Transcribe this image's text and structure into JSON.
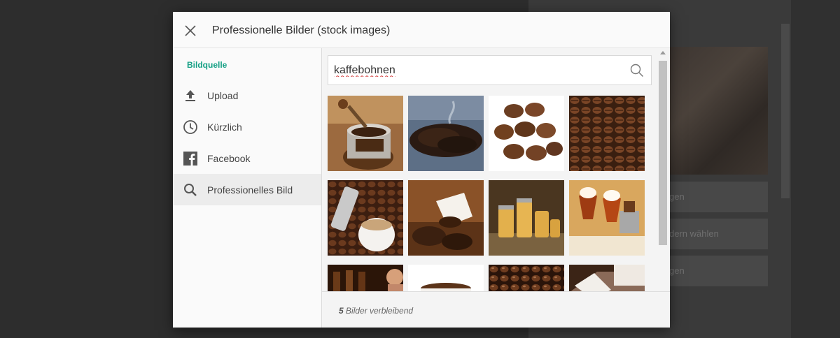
{
  "modal": {
    "title": "Professionelle Bilder (stock images)",
    "close_icon": "close-icon"
  },
  "sidebar": {
    "heading": "Bildquelle",
    "heading_color": "#16a085",
    "items": [
      {
        "label": "Upload",
        "icon": "upload-icon"
      },
      {
        "label": "Kürzlich",
        "icon": "clock-icon"
      },
      {
        "label": "Facebook",
        "icon": "facebook-icon"
      },
      {
        "label": "Professionelles Bild",
        "icon": "search-icon",
        "active": true
      }
    ]
  },
  "search": {
    "value": "kaffebohnen",
    "icon": "search-icon"
  },
  "results": {
    "thumbnails": [
      "coffee grinder with beans",
      "roasted beans on dark surface",
      "coffee beans close-up",
      "coffee beans texture",
      "metal cup and white cup on beans",
      "spilled cup of beans",
      "coffee canisters",
      "coffee drinks with cream",
      "woman with coffee",
      "cup on white",
      "coffee beans",
      "cups and saucers"
    ]
  },
  "footer": {
    "count": "5",
    "text": " Bilder verbleibend"
  },
  "background": {
    "buttons": [
      "gen",
      "dern wählen",
      "gen"
    ]
  }
}
